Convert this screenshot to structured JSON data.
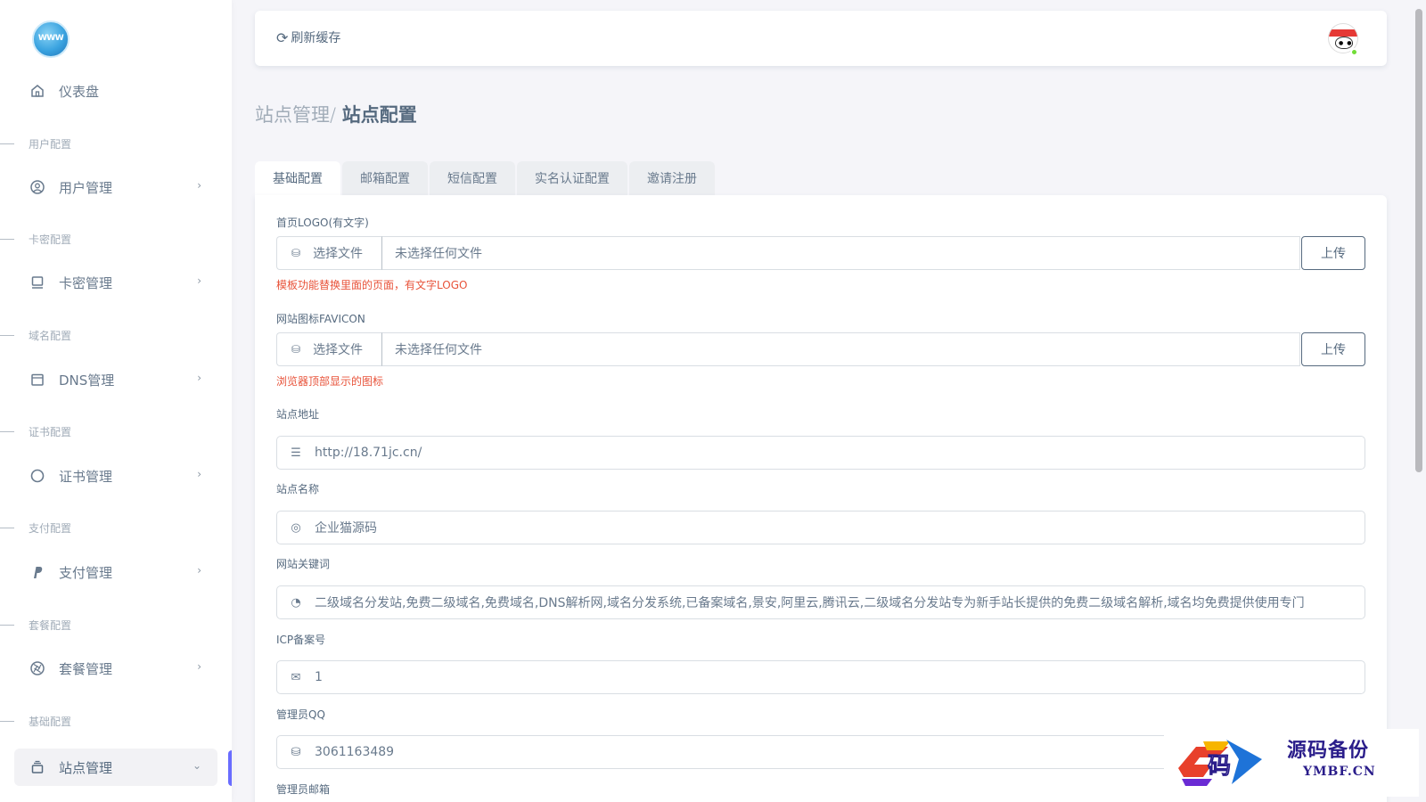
{
  "sidebar": {
    "logo_text": "WWW",
    "dashboard": "仪表盘",
    "sections": [
      {
        "header": "用户配置",
        "item": "用户管理"
      },
      {
        "header": "卡密配置",
        "item": "卡密管理"
      },
      {
        "header": "域名配置",
        "item": "DNS管理"
      },
      {
        "header": "证书配置",
        "item": "证书管理"
      },
      {
        "header": "支付配置",
        "item": "支付管理"
      },
      {
        "header": "套餐配置",
        "item": "套餐管理"
      },
      {
        "header": "基础配置",
        "item": "站点管理"
      }
    ]
  },
  "navbar": {
    "refresh_label": "刷新缓存"
  },
  "breadcrumb": {
    "parent": "站点管理/",
    "current": "站点配置"
  },
  "tabs": [
    "基础配置",
    "邮箱配置",
    "短信配置",
    "实名认证配置",
    "邀请注册"
  ],
  "form": {
    "logo": {
      "label": "首页LOGO(有文字)",
      "choose": "选择文件",
      "status": "未选择任何文件",
      "upload": "上传",
      "hint": "模板功能替换里面的页面，有文字LOGO"
    },
    "favicon": {
      "label": "网站图标FAVICON",
      "choose": "选择文件",
      "status": "未选择任何文件",
      "upload": "上传",
      "hint": "浏览器顶部显示的图标"
    },
    "site_url": {
      "label": "站点地址",
      "value": "http://18.71jc.cn/"
    },
    "site_name": {
      "label": "站点名称",
      "value": "企业猫源码"
    },
    "keywords": {
      "label": "网站关键词",
      "value": "二级域名分发站,免费二级域名,免费域名,DNS解析网,域名分发系统,已备案域名,景安,阿里云,腾讯云,二级域名分发站专为新手站长提供的免费二级域名解析,域名均免费提供使用专门"
    },
    "icp": {
      "label": "ICP备案号",
      "value": "1"
    },
    "admin_qq": {
      "label": "管理员QQ",
      "value": "3061163489"
    },
    "admin_email": {
      "label": "管理员邮箱"
    }
  },
  "watermark": {
    "mark": "码",
    "title": "源码备份",
    "subtitle": "YMBF.CN"
  },
  "colors": {
    "accent": "#696cff",
    "hint_red": "#e8533a",
    "online": "#71dd37"
  }
}
